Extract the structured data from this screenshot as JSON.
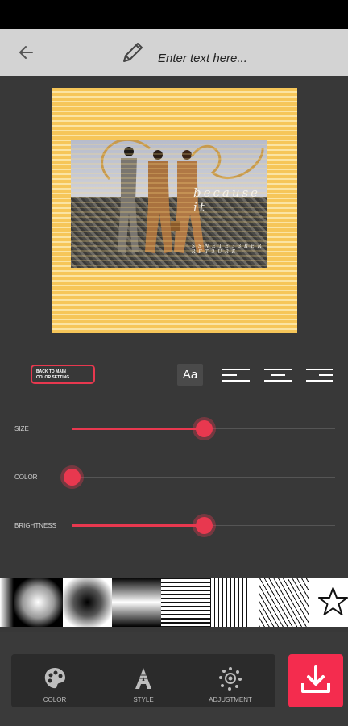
{
  "header": {
    "text_placeholder": "Enter text here..."
  },
  "canvas": {
    "overlay_text": "because it",
    "overlay_small": "S S N E T E 3 3 R E R R E T 3 U R E"
  },
  "controls": {
    "back_button_label_line1": "BACK TO MAIN",
    "back_button_label_line2": "COLOR SETTING",
    "font_button": "Aa"
  },
  "sliders": [
    {
      "label": "SIZE",
      "value": 0.5
    },
    {
      "label": "COLOR",
      "value": 0.0
    },
    {
      "label": "BRIGHTNESS",
      "value": 0.5
    }
  ],
  "bottom_nav": {
    "color": "COLOR",
    "style": "STYLE",
    "adjustment": "ADJUSTMENT"
  },
  "accent_color": "#e8384f",
  "canvas_color": "#f6c659"
}
